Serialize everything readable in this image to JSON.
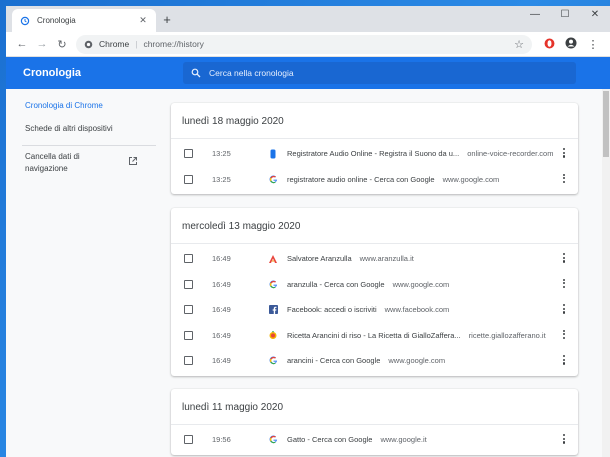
{
  "tab": {
    "title": "Cronologia",
    "close": "✕"
  },
  "newtab": "+",
  "window_controls": {
    "minimize": "—",
    "maximize": "☐",
    "close": "✕"
  },
  "toolbar": {
    "back": "←",
    "forward": "→",
    "reload": "↻",
    "site_label": "Chrome",
    "separator": "|",
    "url": "chrome://history",
    "star": "☆",
    "menu": "⋮"
  },
  "history": {
    "title": "Cronologia",
    "search_placeholder": "Cerca nella cronologia"
  },
  "sidebar": {
    "items": [
      {
        "label": "Cronologia di Chrome",
        "active": true
      },
      {
        "label": "Schede di altri dispositivi",
        "active": false
      }
    ],
    "clear_line1": "Cancella dati di",
    "clear_line2": "navigazione"
  },
  "groups": [
    {
      "date": "lunedì 18 maggio 2020",
      "rows": [
        {
          "time": "13:25",
          "favicon": "recorder-icon",
          "title": "Registratore Audio Online - Registra il Suono da u...",
          "domain": "online-voice-recorder.com"
        },
        {
          "time": "13:25",
          "favicon": "google-icon",
          "title": "registratore audio online - Cerca con Google",
          "domain": "www.google.com"
        }
      ]
    },
    {
      "date": "mercoledì 13 maggio 2020",
      "rows": [
        {
          "time": "16:49",
          "favicon": "aranzulla-icon",
          "title": "Salvatore Aranzulla",
          "domain": "www.aranzulla.it"
        },
        {
          "time": "16:49",
          "favicon": "google-icon",
          "title": "aranzulla - Cerca con Google",
          "domain": "www.google.com"
        },
        {
          "time": "16:49",
          "favicon": "facebook-icon",
          "title": "Facebook: accedi o iscriviti",
          "domain": "www.facebook.com"
        },
        {
          "time": "16:49",
          "favicon": "giallozafferano-icon",
          "title": "Ricetta Arancini di riso - La Ricetta di GialloZaffera...",
          "domain": "ricette.giallozafferano.it"
        },
        {
          "time": "16:49",
          "favicon": "google-icon",
          "title": "arancini - Cerca con Google",
          "domain": "www.google.com"
        }
      ]
    },
    {
      "date": "lunedì 11 maggio 2020",
      "rows": [
        {
          "time": "19:56",
          "favicon": "google-icon",
          "title": "Gatto - Cerca con Google",
          "domain": "www.google.it"
        }
      ]
    }
  ],
  "colors": {
    "accent": "#1a73e8",
    "header_search": "#1967d2"
  }
}
